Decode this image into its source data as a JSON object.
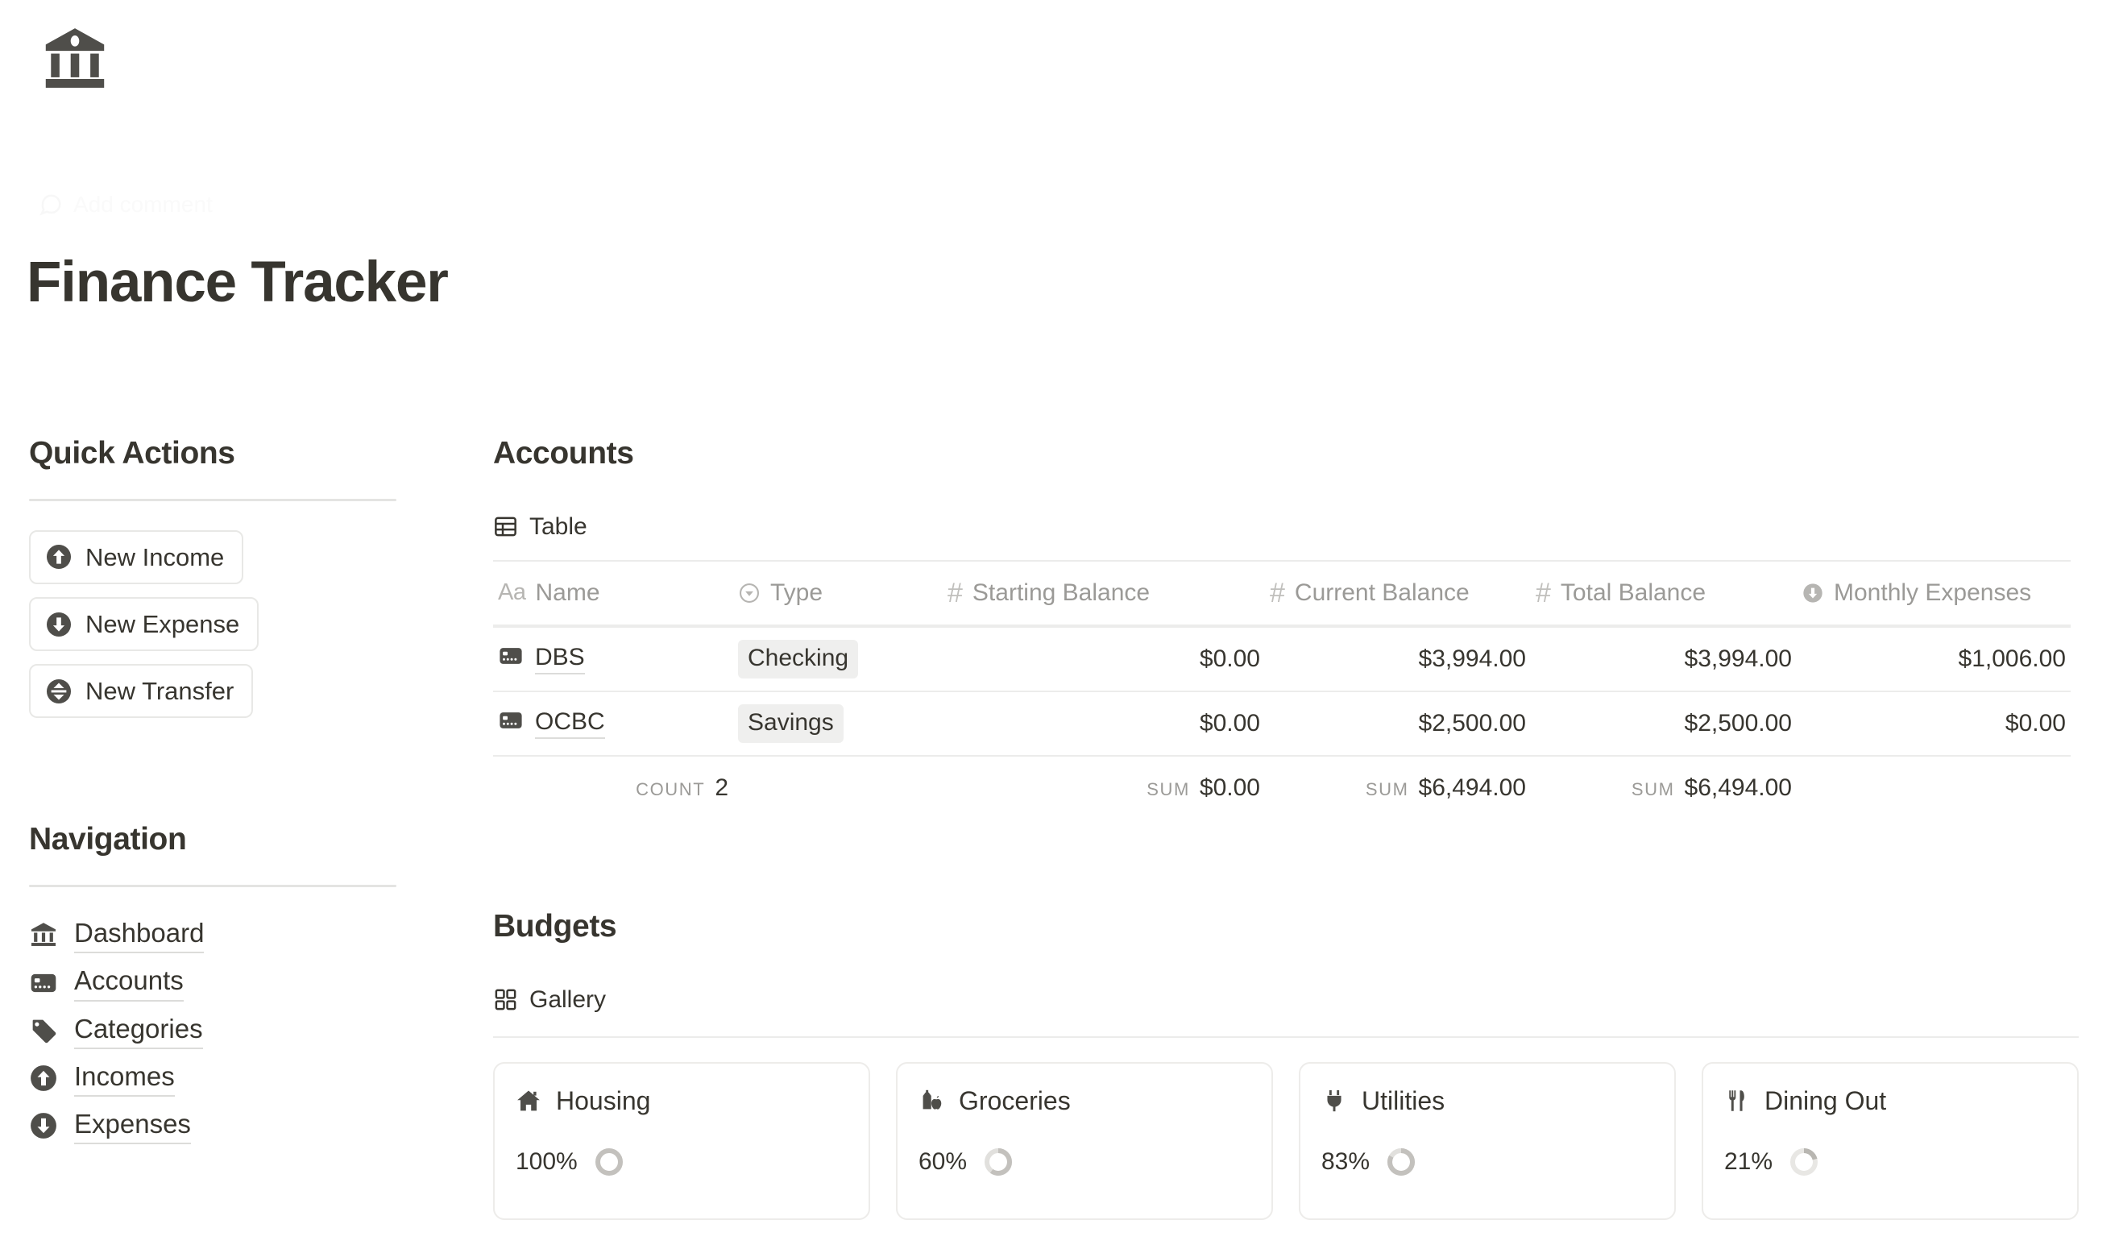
{
  "header": {
    "page_icon": "bank-icon",
    "add_comment_label": "Add comment",
    "title": "Finance Tracker"
  },
  "quick_actions": {
    "heading": "Quick Actions",
    "buttons": [
      {
        "label": "New Income",
        "icon": "arrow-up-circle-icon"
      },
      {
        "label": "New Expense",
        "icon": "arrow-down-circle-icon"
      },
      {
        "label": "New Transfer",
        "icon": "transfer-arrows-circle-icon"
      }
    ]
  },
  "navigation": {
    "heading": "Navigation",
    "items": [
      {
        "label": "Dashboard",
        "icon": "bank-icon"
      },
      {
        "label": "Accounts",
        "icon": "credit-card-icon"
      },
      {
        "label": "Categories",
        "icon": "tag-icon"
      },
      {
        "label": "Incomes",
        "icon": "arrow-up-circle-icon"
      },
      {
        "label": "Expenses",
        "icon": "arrow-down-circle-icon"
      }
    ]
  },
  "accounts": {
    "heading": "Accounts",
    "view_label": "Table",
    "view_icon": "table-icon",
    "columns": [
      {
        "label": "Name",
        "icon": "title-text-icon"
      },
      {
        "label": "Type",
        "icon": "select-chevron-icon"
      },
      {
        "label": "Starting Balance",
        "icon": "number-hash-icon"
      },
      {
        "label": "Current Balance",
        "icon": "number-hash-icon"
      },
      {
        "label": "Total Balance",
        "icon": "number-hash-icon"
      },
      {
        "label": "Monthly Expenses",
        "icon": "arrow-down-circle-icon"
      }
    ],
    "rows": [
      {
        "name": "DBS",
        "icon": "credit-card-icon",
        "type": "Checking",
        "starting_balance": "$0.00",
        "current_balance": "$3,994.00",
        "total_balance": "$3,994.00",
        "monthly_expenses": "$1,006.00"
      },
      {
        "name": "OCBC",
        "icon": "credit-card-icon",
        "type": "Savings",
        "starting_balance": "$0.00",
        "current_balance": "$2,500.00",
        "total_balance": "$2,500.00",
        "monthly_expenses": "$0.00"
      }
    ],
    "summary": {
      "count_label": "Count",
      "count_value": "2",
      "starting_sum_label": "Sum",
      "starting_sum_value": "$0.00",
      "current_sum_label": "Sum",
      "current_sum_value": "$6,494.00",
      "total_sum_label": "Sum",
      "total_sum_value": "$6,494.00"
    }
  },
  "budgets": {
    "heading": "Budgets",
    "view_label": "Gallery",
    "view_icon": "gallery-grid-icon",
    "cards": [
      {
        "title": "Housing",
        "icon": "house-icon",
        "percent_label": "100%",
        "percent": 100
      },
      {
        "title": "Groceries",
        "icon": "milk-apple-icon",
        "percent_label": "60%",
        "percent": 60
      },
      {
        "title": "Utilities",
        "icon": "plug-icon",
        "percent_label": "83%",
        "percent": 83
      },
      {
        "title": "Dining Out",
        "icon": "fork-knife-icon",
        "percent_label": "21%",
        "percent": 21
      }
    ]
  },
  "colors": {
    "text": "#37352f",
    "muted": "#9b9a97",
    "rule": "#ececeb",
    "tag_bg": "#efefee",
    "ring_track": "#e3e2e0",
    "ring_fill": "#a8a6a1"
  }
}
